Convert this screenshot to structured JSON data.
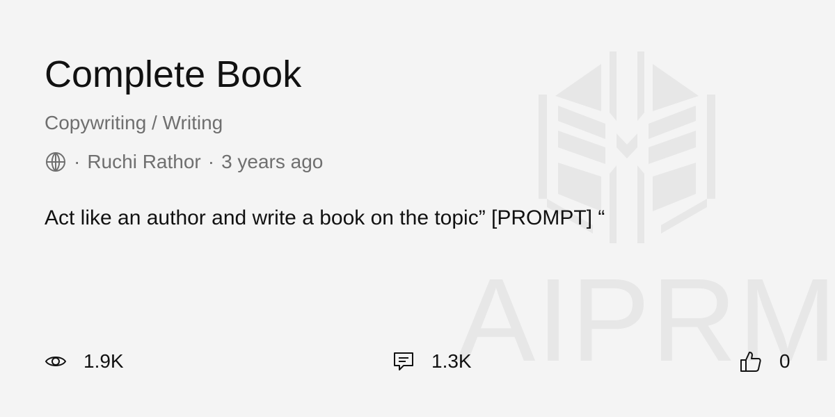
{
  "prompt": {
    "title": "Complete Book",
    "category": "Copywriting / Writing",
    "author": "Ruchi Rathor",
    "age": "3 years ago",
    "separator": "·",
    "description": "Act like an author and write a book on the topic” [PROMPT] “"
  },
  "stats": {
    "views": "1.9K",
    "comments": "1.3K",
    "likes": "0"
  },
  "watermark": {
    "text": "AIPRM"
  },
  "icons": {
    "visibility": "globe-icon",
    "views": "eye-icon",
    "comments": "comment-icon",
    "likes": "thumbs-up-icon",
    "logo": "aiprm-logo"
  },
  "colors": {
    "background": "#f4f4f4",
    "text": "#111111",
    "muted": "#6f6f6f",
    "watermark": "#e7e7e7"
  }
}
